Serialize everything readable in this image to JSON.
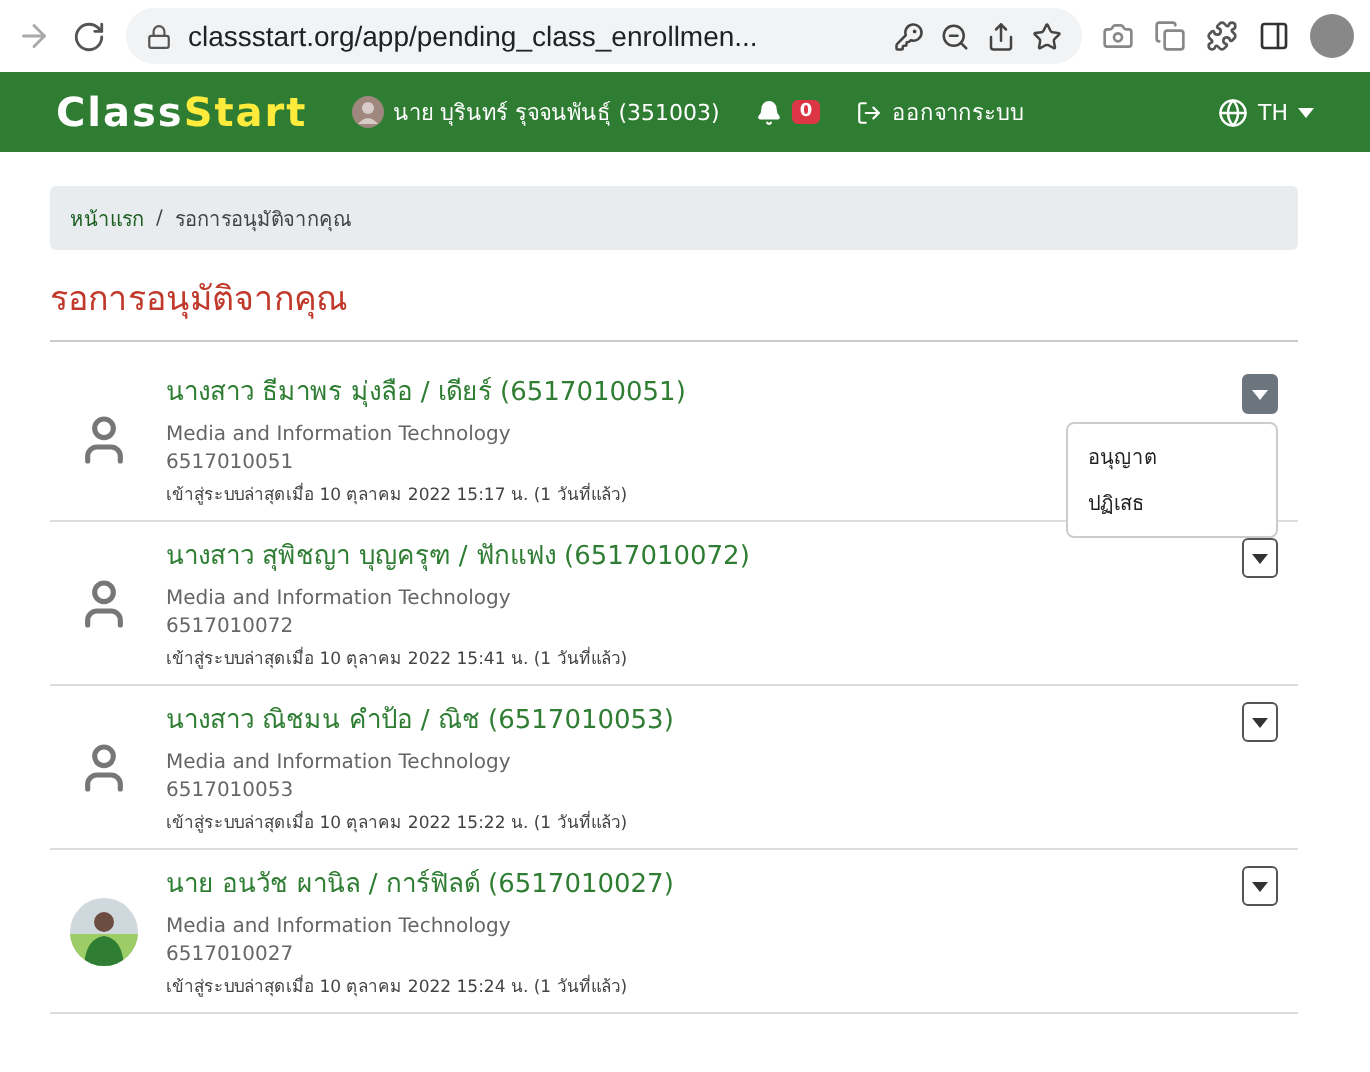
{
  "browser": {
    "url": "classstart.org/app/pending_class_enrollmen..."
  },
  "navbar": {
    "logo_left": "Class",
    "logo_right": "Start",
    "user": "นาย บุรินทร์ รุจจนพันธุ์ (351003)",
    "notifications": "0",
    "logout": "ออกจากระบบ",
    "language": "TH"
  },
  "breadcrumb": [
    {
      "label": "หน้าแรก",
      "kind": "link"
    },
    {
      "label": "/",
      "kind": "separator"
    },
    {
      "label": "รอการอนุมัติจากคุณ",
      "kind": "current"
    }
  ],
  "title": "รอการอนุมัติจากคุณ",
  "requests": [
    {
      "name": "นางสาว ธีมาพร มุ่งลือ / เดียร์ (6517010051)",
      "department": "Media and Information Technology",
      "student_id": "6517010051",
      "last_login": "เข้าสู่ระบบล่าสุดเมื่อ 10 ตุลาคม 2022 15:17 น. (1 วันที่แล้ว)",
      "kind": "placeholder",
      "expanded": true,
      "menu": [
        "อนุญาต",
        "ปฏิเสธ"
      ]
    },
    {
      "name": "นางสาว สุพิชญา บุญครุฑ / ฟักแฟง (6517010072)",
      "department": "Media and Information Technology",
      "student_id": "6517010072",
      "last_login": "เข้าสู่ระบบล่าสุดเมื่อ 10 ตุลาคม 2022 15:41 น. (1 วันที่แล้ว)",
      "kind": "placeholder",
      "expanded": false
    },
    {
      "name": "นางสาว ณิชมน คำป้อ / ณิช (6517010053)",
      "department": "Media and Information Technology",
      "student_id": "6517010053",
      "last_login": "เข้าสู่ระบบล่าสุดเมื่อ 10 ตุลาคม 2022 15:22 น. (1 วันที่แล้ว)",
      "kind": "placeholder",
      "expanded": false
    },
    {
      "name": "นาย อนวัช ผานิล / การ์ฟิลด์ (6517010027)",
      "department": "Media and Information Technology",
      "student_id": "6517010027",
      "last_login": "เข้าสู่ระบบล่าสุดเมื่อ 10 ตุลาคม 2022 15:24 น. (1 วันที่แล้ว)",
      "expanded": false
    }
  ]
}
